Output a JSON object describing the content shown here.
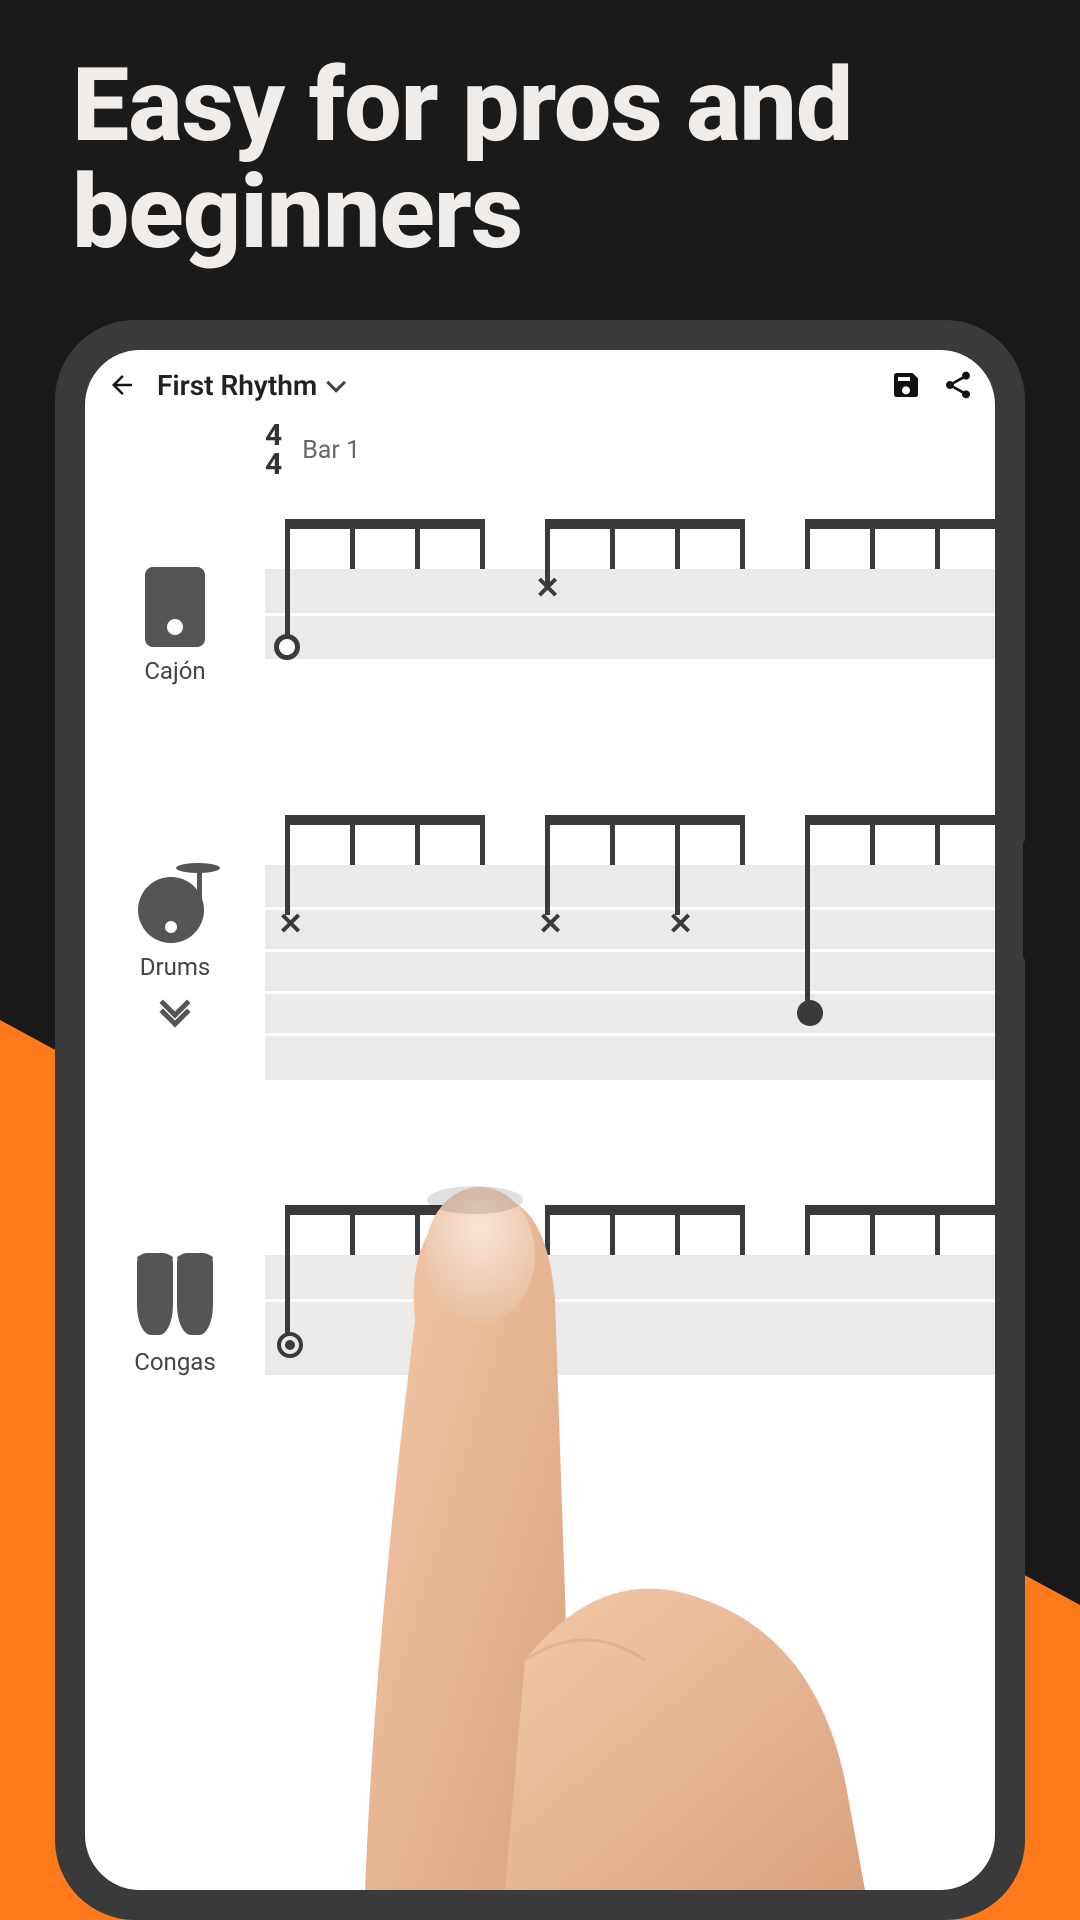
{
  "headline": "Easy for pros and beginners",
  "topbar": {
    "title": "First Rhythm"
  },
  "timesig": {
    "top": "4",
    "bottom": "4"
  },
  "bar_label": "Bar 1",
  "instruments": {
    "cajon": "Cajón",
    "drums": "Drums",
    "congas": "Congas"
  }
}
